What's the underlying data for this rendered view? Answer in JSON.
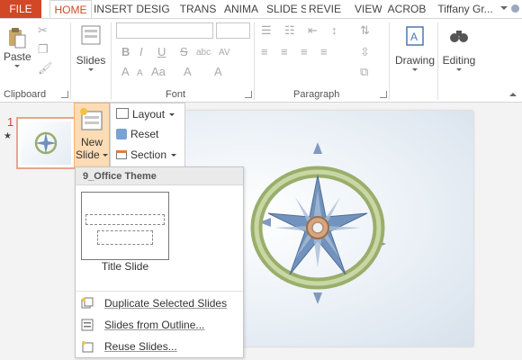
{
  "tabs": [
    {
      "label": "FILE"
    },
    {
      "label": "HOME"
    },
    {
      "label": "INSERT"
    },
    {
      "label": "DESIG"
    },
    {
      "label": "TRANS"
    },
    {
      "label": "ANIMA"
    },
    {
      "label": "SLIDE S"
    },
    {
      "label": "REVIE"
    },
    {
      "label": "VIEW"
    },
    {
      "label": "ACROB"
    }
  ],
  "user": {
    "name": "Tiffany Gr..."
  },
  "ribbon": {
    "clipboard": {
      "paste_label": "Paste",
      "group_label": "Clipboard"
    },
    "slides": {
      "slides_label": "Slides"
    },
    "font": {
      "group_label": "Font",
      "bold": "B",
      "italic": "I",
      "underline": "U",
      "strike": "S",
      "grow": "A",
      "shrink": "A",
      "case": "Aa",
      "clear": "A",
      "fontcolor": "A"
    },
    "paragraph": {
      "group_label": "Paragraph"
    },
    "drawing": {
      "label": "Drawing"
    },
    "editing": {
      "label": "Editing"
    }
  },
  "thumbnails": {
    "slide_number": "1",
    "marker": "★"
  },
  "new_slide_dropdown": {
    "new_label": "New",
    "slide_label": "Slide",
    "layout_label": "Layout",
    "reset_label": "Reset",
    "section_label": "Section",
    "theme_header": "9_Office Theme",
    "layout_name": "Title Slide",
    "items": [
      {
        "label": "Duplicate Selected Slides"
      },
      {
        "label": "Slides from Outline..."
      },
      {
        "label": "Reuse Slides..."
      }
    ]
  },
  "colors": {
    "accent": "#d24726",
    "newslide_bg": "#fcdcb4",
    "compass_ring": "#9aae6c",
    "compass_star": "#6d8fb8"
  }
}
